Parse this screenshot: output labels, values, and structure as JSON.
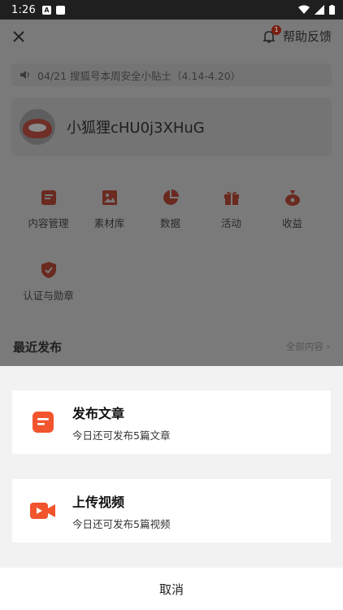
{
  "status_bar": {
    "time": "1:26"
  },
  "header": {
    "help_label": "帮助反馈",
    "notification_count": "1"
  },
  "notice": {
    "text": "04/21 搜狐号本周安全小贴士（4.14-4.20）"
  },
  "profile": {
    "username": "小狐狸cHU0j3XHuG"
  },
  "menu": {
    "items": [
      {
        "label": "内容管理",
        "icon": "document-icon"
      },
      {
        "label": "素材库",
        "icon": "image-icon"
      },
      {
        "label": "数据",
        "icon": "pie-chart-icon"
      },
      {
        "label": "活动",
        "icon": "gift-icon"
      },
      {
        "label": "收益",
        "icon": "money-bag-icon"
      },
      {
        "label": "认证与勋章",
        "icon": "shield-check-icon"
      }
    ]
  },
  "recent": {
    "title": "最近发布",
    "all_link": "全部内容"
  },
  "sheet": {
    "options": [
      {
        "title": "发布文章",
        "subtitle": "今日还可发布5篇文章",
        "icon": "article-icon"
      },
      {
        "title": "上传视频",
        "subtitle": "今日还可发布5篇视频",
        "icon": "video-camera-icon"
      }
    ],
    "cancel_label": "取消"
  },
  "colors": {
    "accent": "#f2542d",
    "dim_overlay": "#7a7a7a"
  }
}
